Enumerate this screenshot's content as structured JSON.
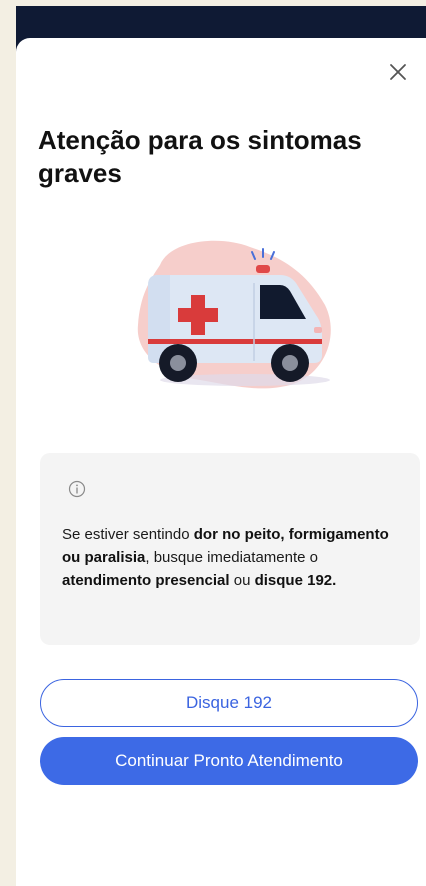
{
  "modal": {
    "title": "Atenção para os sintomas graves",
    "close_icon": "close-icon",
    "illustration": "ambulance-illustration"
  },
  "info": {
    "icon": "info-icon",
    "segments": [
      {
        "text": "Se estiver sentindo ",
        "bold": false
      },
      {
        "text": "dor no peito, formigamento ou paralisia",
        "bold": true
      },
      {
        "text": ", busque imediatamente o ",
        "bold": false
      },
      {
        "text": "atendimento presencial",
        "bold": true
      },
      {
        "text": " ou ",
        "bold": false
      },
      {
        "text": "disque 192.",
        "bold": true
      }
    ]
  },
  "buttons": {
    "call_label": "Disque 192",
    "continue_label": "Continuar Pronto Atendimento"
  },
  "colors": {
    "accent": "#3d6ae6",
    "header_dark": "#0f1a34",
    "page_bg": "#f3efe3",
    "info_bg": "#f4f4f4"
  }
}
